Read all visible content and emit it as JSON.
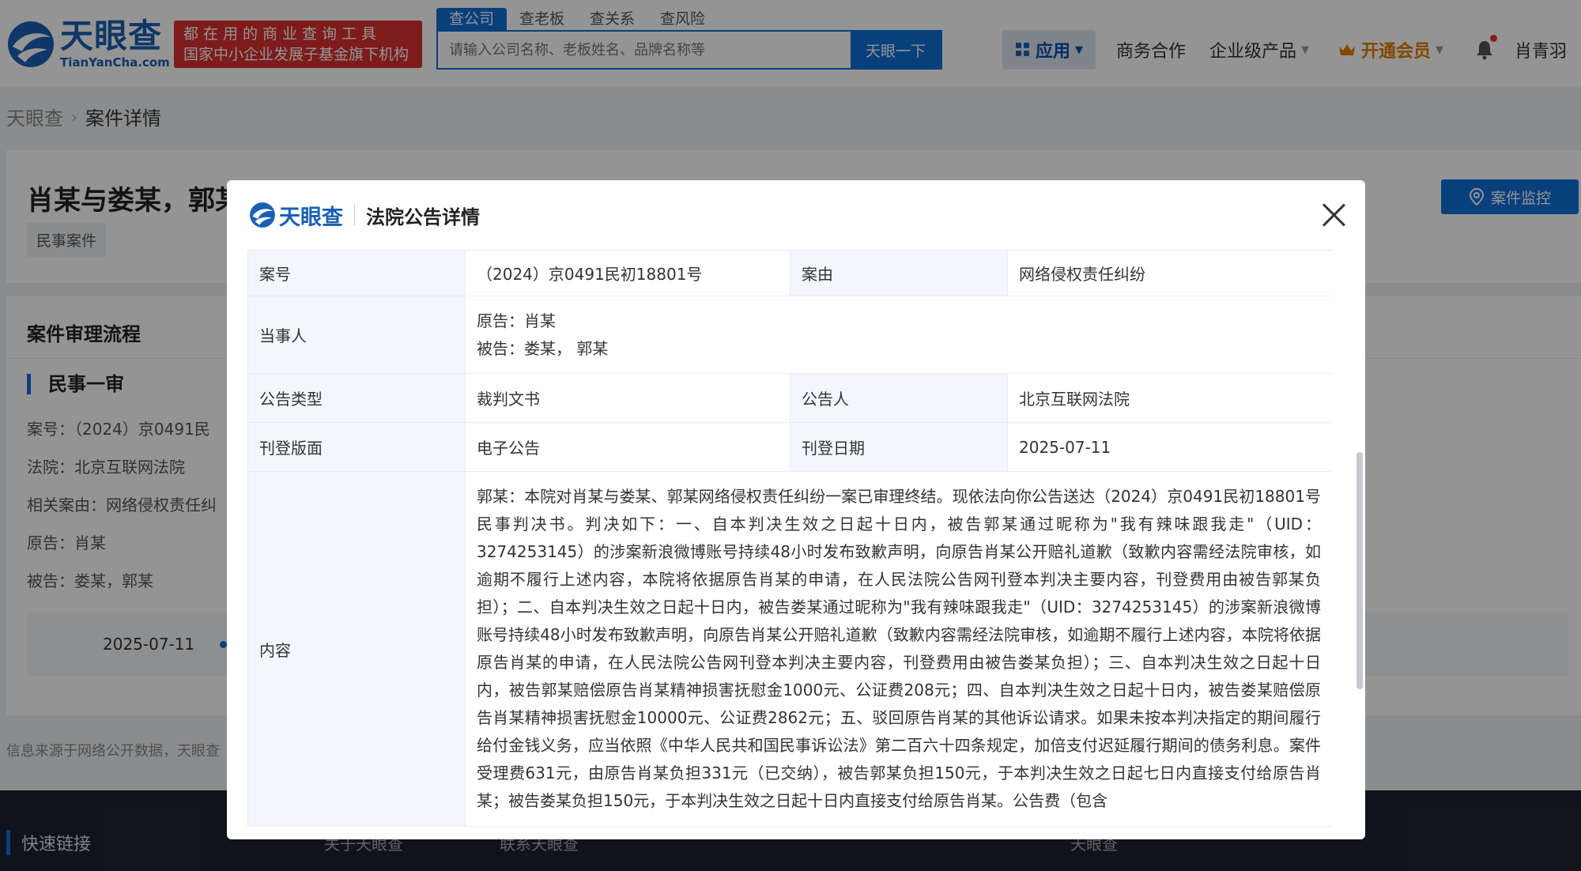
{
  "header": {
    "logo_cn": "天眼查",
    "logo_en": "TianYanCha.com",
    "slogan_line1": "都在用的商业查询工具",
    "slogan_line2": "国家中小企业发展子基金旗下机构",
    "search_tabs": [
      "查公司",
      "查老板",
      "查关系",
      "查风险"
    ],
    "search_placeholder": "请输入公司名称、老板姓名、品牌名称等",
    "search_button": "天眼一下",
    "nav_apps": "应用",
    "nav_business": "商务合作",
    "nav_enterprise": "企业级产品",
    "nav_vip": "开通会员",
    "user_name": "肖青羽"
  },
  "breadcrumb": {
    "home": "天眼查",
    "current": "案件详情"
  },
  "case_card": {
    "title": "肖某与娄某，郭某",
    "tag": "民事案件",
    "monitor_button": "案件监控"
  },
  "flow_card": {
    "title": "案件审理流程",
    "stage": "民事一审",
    "case_no": "案号：（2024）京0491民",
    "court": "法院：北京互联网法院",
    "cause": "相关案由：网络侵权责任纠",
    "plaintiff": "原告：肖某",
    "defendant": "被告：娄某，郭某",
    "timeline_date": "2025-07-11"
  },
  "source_note": "信息来源于网络公开数据，天眼查",
  "footer": {
    "quick_links": "快速链接",
    "links": [
      "关于天眼查",
      "联系天眼查",
      "天眼查"
    ]
  },
  "modal": {
    "logo_cn": "天眼查",
    "title": "法院公告详情",
    "rows": {
      "case_no_label": "案号",
      "case_no": "（2024）京0491民初18801号",
      "cause_label": "案由",
      "cause": "网络侵权责任纠纷",
      "parties_label": "当事人",
      "plaintiff": "原告：肖某",
      "defendant": "被告：娄某， 郭某",
      "type_label": "公告类型",
      "type": "裁判文书",
      "announcer_label": "公告人",
      "announcer": "北京互联网法院",
      "layout_label": "刊登版面",
      "layout": "电子公告",
      "date_label": "刊登日期",
      "date": "2025-07-11",
      "content_label": "内容",
      "content": "郭某：本院对肖某与娄某、郭某网络侵权责任纠纷一案已审理终结。现依法向你公告送达（2024）京0491民初18801号民事判决书。判决如下：一、自本判决生效之日起十日内，被告郭某通过昵称为\"我有辣味跟我走\"（UID：3274253145）的涉案新浪微博账号持续48小时发布致歉声明，向原告肖某公开赔礼道歉（致歉内容需经法院审核，如逾期不履行上述内容，本院将依据原告肖某的申请，在人民法院公告网刊登本判决主要内容，刊登费用由被告郭某负担）；二、自本判决生效之日起十日内，被告娄某通过昵称为\"我有辣味跟我走\"（UID：3274253145）的涉案新浪微博账号持续48小时发布致歉声明，向原告肖某公开赔礼道歉（致歉内容需经法院审核，如逾期不履行上述内容，本院将依据原告肖某的申请，在人民法院公告网刊登本判决主要内容，刊登费用由被告娄某负担）；三、自本判决生效之日起十日内，被告郭某赔偿原告肖某精神损害抚慰金1000元、公证费208元；四、自本判决生效之日起十日内，被告娄某赔偿原告肖某精神损害抚慰金10000元、公证费2862元；五、驳回原告肖某的其他诉讼请求。如果未按本判决指定的期间履行给付金钱义务，应当依照《中华人民共和国民事诉讼法》第二百六十四条规定，加倍支付迟延履行期间的债务利息。案件受理费631元，由原告肖某负担331元（已交纳），被告郭某负担150元，于本判决生效之日起七日内直接支付给原告肖某；被告娄某负担150元，于本判决生效之日起十日内直接支付给原告肖某。公告费（包含"
    }
  }
}
